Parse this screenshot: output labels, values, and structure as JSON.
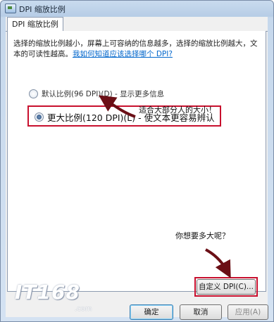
{
  "window": {
    "title": "DPI 缩放比例"
  },
  "tabs": [
    {
      "label": "DPI 缩放比例"
    }
  ],
  "description": {
    "text": "选择的缩放比例越小，屏幕上可容纳的信息越多，选择的缩放比例越大，文本的可读性越高。",
    "link": "我如何知道应该选择哪个 DPI?"
  },
  "options": [
    {
      "label": "默认比例(96 DPI)(D) - 显示更多信息",
      "selected": false
    },
    {
      "label": "更大比例(120 DPI)(L) - 使文本更容易辨认",
      "selected": true
    }
  ],
  "annotations": {
    "suits_most": "适合大部分人的大小！",
    "how_big": "你想要多大呢？"
  },
  "buttons": {
    "custom_dpi": "自定义 DPI(C)...",
    "ok": "确定",
    "cancel": "取消",
    "apply": "应用(A)"
  },
  "watermark": {
    "logo": "IT168",
    "sub": ".com"
  },
  "colors": {
    "highlight": "#c8102e",
    "link": "#0066cc"
  }
}
